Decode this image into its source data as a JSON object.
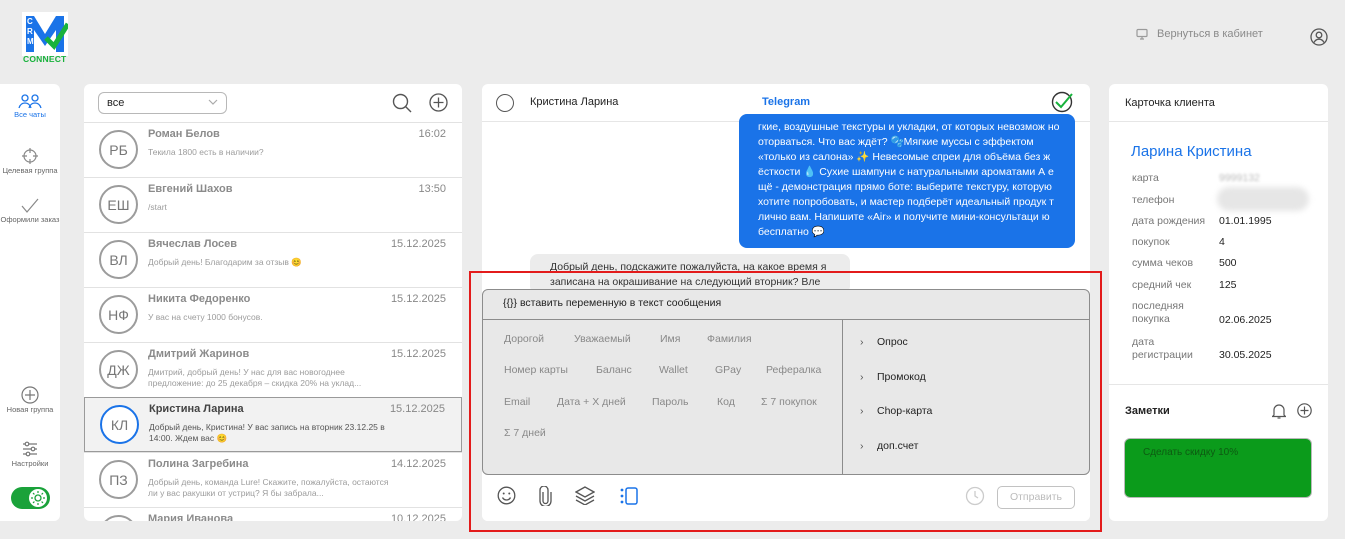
{
  "logo": {
    "brand_text": "CONNECT",
    "letters": "CRM"
  },
  "header": {
    "back_label": "Вернуться в кабинет",
    "icons": [
      "monitor-icon",
      "user-icon"
    ]
  },
  "nav": {
    "all_chats": "Все чаты",
    "target_group": "Целевая группа",
    "make_order": "Оформили заказ",
    "new_group": "Новая группа",
    "settings": "Настройки"
  },
  "chatlist": {
    "filter_value": "все",
    "rows": [
      {
        "initials": "РБ",
        "name": "Роман Белов",
        "time": "16:02",
        "preview": "Текила 1800 есть в наличии?"
      },
      {
        "initials": "ЕШ",
        "name": "Евгений Шахов",
        "time": "13:50",
        "preview": "/start"
      },
      {
        "initials": "ВЛ",
        "name": "Вячеслав Лосев",
        "time": "15.12.2025",
        "preview": "Добрый день! Благодарим за отзыв 😊"
      },
      {
        "initials": "НФ",
        "name": "Никита Федоренко",
        "time": "15.12.2025",
        "preview": "У вас на счету 1000 бонусов."
      },
      {
        "initials": "ДЖ",
        "name": "Дмитрий Жаринов",
        "time": "15.12.2025",
        "preview": "Дмитрий, добрый день! У нас для вас новогоднее предложение: до 25 декабря – скидка 20% на уклад..."
      },
      {
        "initials": "КЛ",
        "name": "Кристина Ларина",
        "time": "15.12.2025",
        "preview": "Добрый день, Кристина! У вас запись на вторник 23.12.25 в 14:00. Ждем вас 😊"
      },
      {
        "initials": "ПЗ",
        "name": "Полина Загребина",
        "time": "14.12.2025",
        "preview": "Добрый день, команда Lure! Скажите, пожалуйста, остаются ли у вас ракушки от устриц? Я бы забрала..."
      },
      {
        "initials": "МИ",
        "name": "Мария Иванова",
        "time": "10.12.2025",
        "preview": ""
      }
    ]
  },
  "chat": {
    "contact_name": "Кристина Ларина",
    "channel": "Telegram",
    "outgoing": "гкие, воздушные текстуры и укладки, от которых невозмож но оторваться. Что вас ждёт? 🫧Мягкие муссы с эффектом «только из салона» ✨ Невесомые спреи для объёма без ж ёсткости 💧 Сухие шампуни с натуральными ароматами А е щё - демонстрация прямо боте: выберите текстуру, которую хотите попробовать, и мастер подберёт идеальный продук т лично вам. Напишите «Air» и получите мини-консультаци ю бесплатно 💬",
    "incoming": "Добрый день, подскажите пожалуйста, на какое время я записана на окрашивание на следующий вторник? Вле"
  },
  "variables": {
    "header": "{{}} вставить переменную в текст сообщения",
    "chips": [
      "Дорогой",
      "Уважаемый",
      "Имя",
      "Фамилия",
      "Номер карты",
      "Баланс",
      "Wallet",
      "GPay",
      "Рефералка",
      "Email",
      "Дата + X дней",
      "Пароль",
      "Код",
      "Σ 7 покупок",
      "Σ 7 дней"
    ],
    "list": [
      "Опрос",
      "Промокод",
      "Chop-карта",
      "доп.счет"
    ],
    "send_label": "Отправить"
  },
  "card": {
    "title": "Карточка клиента",
    "client_name": "Ларина Кристина",
    "fields": [
      {
        "label": "карта",
        "value": "9999132"
      },
      {
        "label": "телефон",
        "value": ""
      },
      {
        "label": "дата рождения",
        "value": "01.01.1995"
      },
      {
        "label": "покупок",
        "value": "4"
      },
      {
        "label": "сумма чеков",
        "value": "500"
      },
      {
        "label": "средний чек",
        "value": "125"
      },
      {
        "label": "последняя покупка",
        "value": "02.06.2025"
      },
      {
        "label": "дата регистрации",
        "value": "30.05.2025"
      }
    ],
    "notes_title": "Заметки",
    "note_text": "Сделать скидку 10%"
  },
  "colors": {
    "accent": "#1a73e8",
    "green": "#1aa23a",
    "note": "#0b9b1b",
    "highlight": "#e31b1b"
  }
}
